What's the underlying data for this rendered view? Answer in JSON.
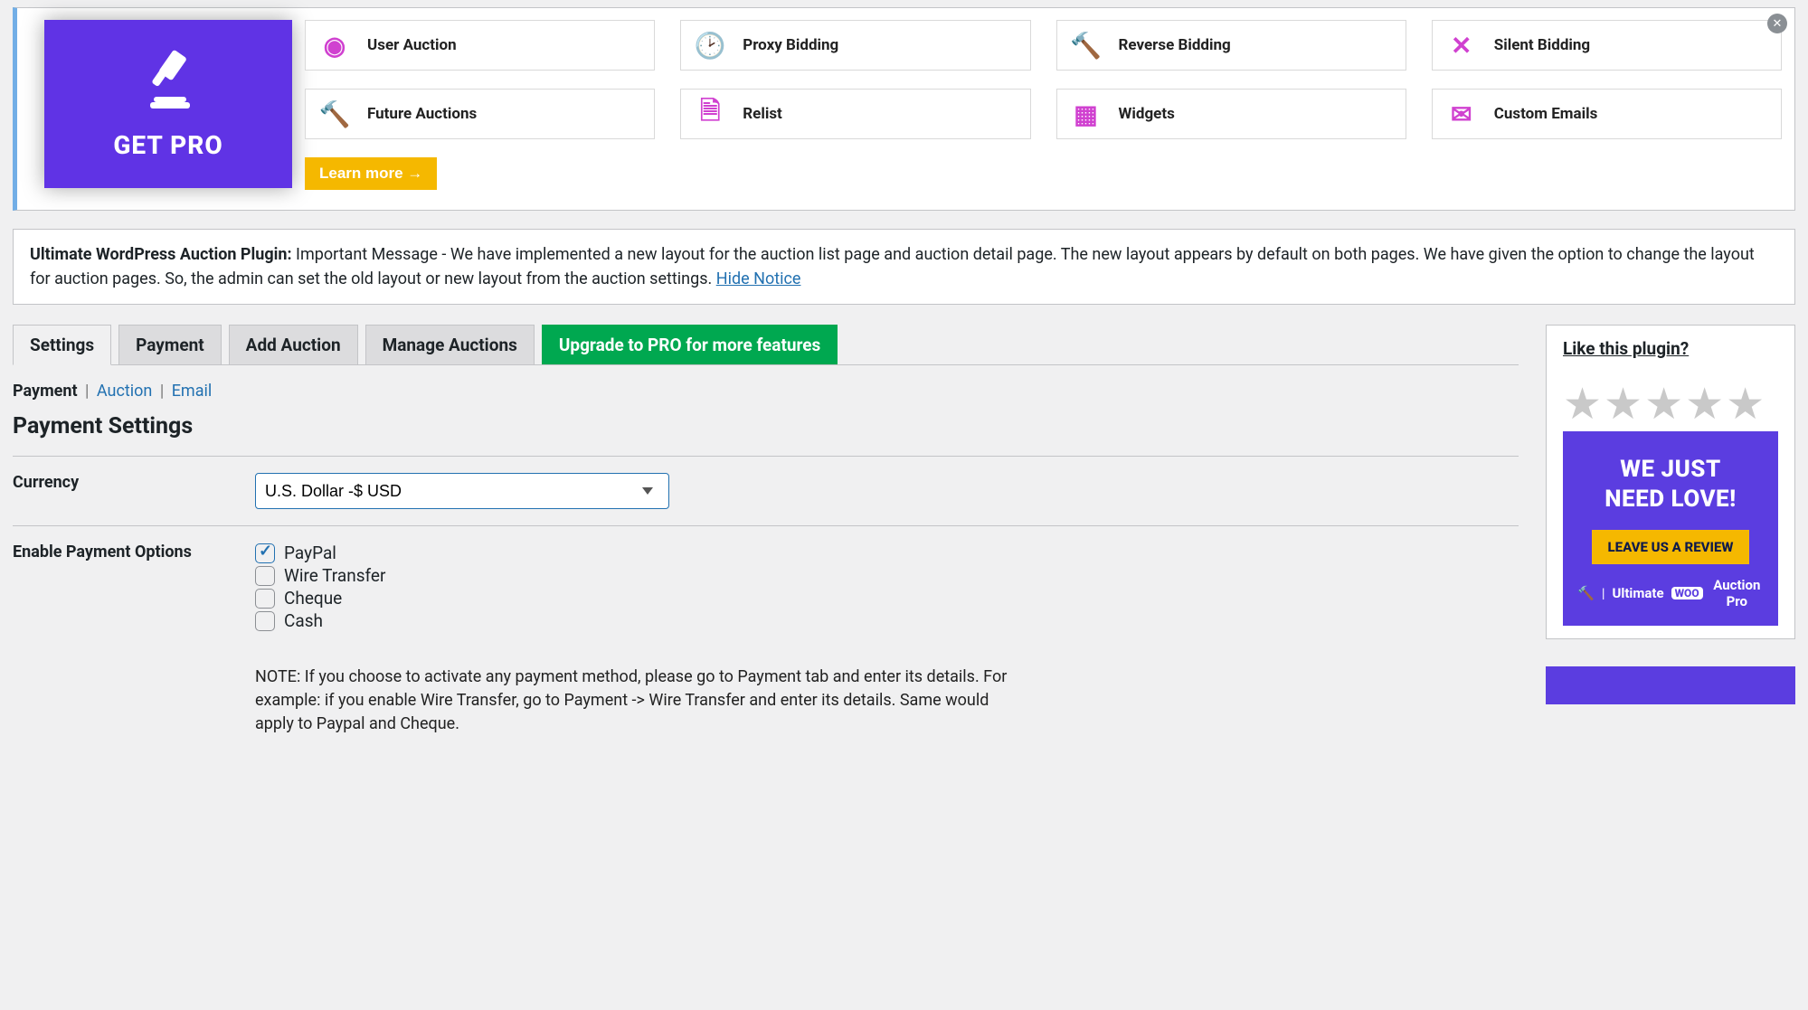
{
  "promo": {
    "hero_text": "GET PRO",
    "features": [
      {
        "label": "User Auction",
        "icon": "user-auction-icon"
      },
      {
        "label": "Proxy Bidding",
        "icon": "proxy-bidding-icon"
      },
      {
        "label": "Reverse Bidding",
        "icon": "reverse-bidding-icon"
      },
      {
        "label": "Silent Bidding",
        "icon": "silent-bidding-icon"
      },
      {
        "label": "Future Auctions",
        "icon": "future-auctions-icon"
      },
      {
        "label": "Relist",
        "icon": "relist-icon"
      },
      {
        "label": "Widgets",
        "icon": "widgets-icon"
      },
      {
        "label": "Custom Emails",
        "icon": "custom-emails-icon"
      }
    ],
    "learn_more": "Learn more →"
  },
  "notice": {
    "prefix": "Ultimate WordPress Auction Plugin:",
    "body": " Important Message - We have implemented a new layout for the auction list page and auction detail page. The new layout appears by default on both pages. We have given the option to change the layout for auction pages. So, the admin can set the old layout or new layout from the auction settings. ",
    "hide": "Hide Notice"
  },
  "tabs": {
    "settings": "Settings",
    "payment": "Payment",
    "add": "Add Auction",
    "manage": "Manage Auctions",
    "upgrade": "Upgrade to PRO for more features"
  },
  "subnav": {
    "payment": "Payment",
    "auction": "Auction",
    "email": "Email"
  },
  "section_title": "Payment Settings",
  "form": {
    "currency_label": "Currency",
    "currency_value": "U.S. Dollar -$ USD",
    "enable_label": "Enable Payment Options",
    "options": {
      "paypal": "PayPal",
      "wire": "Wire Transfer",
      "cheque": "Cheque",
      "cash": "Cash"
    },
    "note": "NOTE: If you choose to activate any payment method, please go to Payment tab and enter its details. For example: if you enable Wire Transfer, go to Payment -> Wire Transfer and enter its details. Same would apply to Paypal and Cheque."
  },
  "sidebar": {
    "like_title": "Like this plugin?",
    "love_line1": "WE JUST",
    "love_line2": "NEED LOVE!",
    "review_btn": "LEAVE US A REVIEW",
    "brand_pre": "Ultimate",
    "brand_woo": "WOO",
    "brand_post": "Auction Pro"
  }
}
